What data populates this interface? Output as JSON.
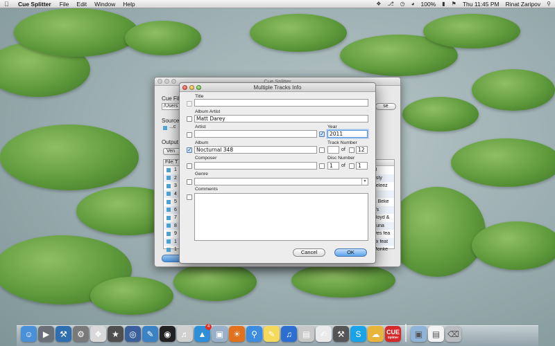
{
  "menubar": {
    "app_name": "Cue Splitter",
    "menus": [
      "File",
      "Edit",
      "Window",
      "Help"
    ],
    "battery": "100%",
    "clock": "Thu 11:45 PM",
    "user": "Rinat Zaripov"
  },
  "main_window": {
    "title": "Cue Splitter",
    "cue_file_label": "Cue Fil",
    "cue_file_path": "/Users",
    "browse_label": "se",
    "source_label": "Source",
    "source_value": "...c",
    "output_label": "Output",
    "output_button": "Ven",
    "table_headers": [
      "File",
      "T"
    ],
    "rows": [
      {
        "num": "1",
        "tail": "al"
      },
      {
        "num": "2",
        "tail": "asty"
      },
      {
        "num": "3",
        "tail": "beleez"
      },
      {
        "num": "4",
        "tail": ""
      },
      {
        "num": "5",
        "tail": "& Beke"
      },
      {
        "num": "6",
        "tail": "Vs"
      },
      {
        "num": "7",
        "tail": "Lloyd &"
      },
      {
        "num": "8",
        "tail": "rtuna"
      },
      {
        "num": "9",
        "tail": "lves fea"
      },
      {
        "num": "1",
        "tail": "ux feat"
      },
      {
        "num": "1",
        "tail": "Monke"
      }
    ]
  },
  "dialog": {
    "title": "Multiple Tracks Info",
    "labels": {
      "title": "Title",
      "album_artist": "Album Artist",
      "artist": "Artist",
      "year": "Year",
      "album": "Album",
      "track_number": "Track Number",
      "composer": "Composer",
      "disc_number": "Disc Number",
      "genre": "Genre",
      "comments": "Comments",
      "of": "of"
    },
    "values": {
      "title": "",
      "album_artist": "Matt Darey",
      "artist": "",
      "year": "2011",
      "album": "Nocturnal 348",
      "track_number": "",
      "track_total": "12",
      "composer": "",
      "disc_number": "1",
      "disc_total": "1",
      "genre": "",
      "comments": ""
    },
    "checked": {
      "year": true,
      "album": true
    },
    "cancel_label": "Cancel",
    "ok_label": "OK"
  },
  "dock": {
    "apps": [
      "Finder",
      "Launchpad",
      "Xcode",
      "System Preferences",
      "Font Book",
      "Dictionary",
      "Instruments",
      "Accessibility Inspector",
      "Photo Booth",
      "Audio MIDI Setup",
      "App Store",
      "Preview",
      "Firefox",
      "Safari",
      "Stickies",
      "iTunes",
      "Activity Monitor",
      "TextEdit",
      "Utility",
      "Skype",
      "WebRadio",
      "Cue Splitter"
    ],
    "trailing": [
      "Applications",
      "Documents",
      "Trash"
    ],
    "app_store_badge": "4",
    "cue_splitter_icon_label": "CUE",
    "cue_splitter_icon_sub": "Splitter"
  }
}
